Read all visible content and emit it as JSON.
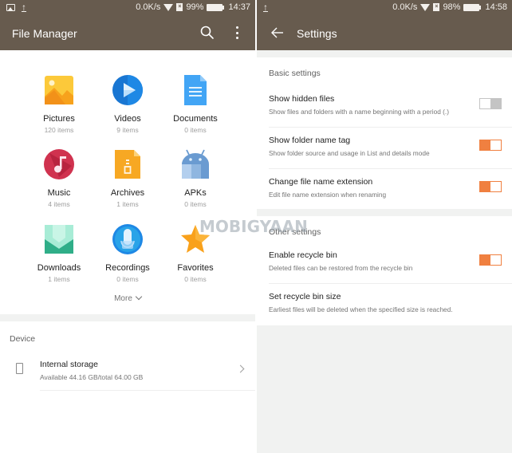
{
  "left_screen": {
    "status_bar": {
      "notification_icons": [
        "image-icon",
        "upload-icon"
      ],
      "network_speed": "0.0K/s",
      "battery": "99%",
      "time": "14:37"
    },
    "app_bar": {
      "title": "File Manager",
      "actions": [
        "search-icon",
        "more-vert-icon"
      ]
    },
    "categories": [
      {
        "name": "Pictures",
        "count": "120 items",
        "icon": "pictures-icon",
        "color": "#fbbf2a"
      },
      {
        "name": "Videos",
        "count": "9 items",
        "icon": "videos-icon",
        "color": "#1976d2"
      },
      {
        "name": "Documents",
        "count": "0 items",
        "icon": "documents-icon",
        "color": "#42a5f5"
      },
      {
        "name": "Music",
        "count": "4 items",
        "icon": "music-icon",
        "color": "#d0324f"
      },
      {
        "name": "Archives",
        "count": "1 items",
        "icon": "archives-icon",
        "color": "#f7a823"
      },
      {
        "name": "APKs",
        "count": "0 items",
        "icon": "apks-icon",
        "color": "#6a9bd1"
      },
      {
        "name": "Downloads",
        "count": "1 items",
        "icon": "downloads-icon",
        "color": "#3cbf9a"
      },
      {
        "name": "Recordings",
        "count": "0 items",
        "icon": "recordings-icon",
        "color": "#1e88e5"
      },
      {
        "name": "Favorites",
        "count": "0 items",
        "icon": "favorites-icon",
        "color": "#f9a11b"
      }
    ],
    "more_label": "More",
    "device": {
      "section_label": "Device",
      "storage": {
        "title": "Internal storage",
        "subtitle": "Available 44.16 GB/total 64.00 GB"
      }
    }
  },
  "right_screen": {
    "status_bar": {
      "notification_icons": [
        "upload-icon"
      ],
      "network_speed": "0.0K/s",
      "battery": "98%",
      "time": "14:58"
    },
    "app_bar": {
      "title": "Settings"
    },
    "basic_settings": {
      "header": "Basic settings",
      "items": [
        {
          "title": "Show hidden files",
          "subtitle": "Show files and folders with a name beginning with a period (.)",
          "enabled": false
        },
        {
          "title": "Show folder name tag",
          "subtitle": "Show folder source and usage in List and details mode",
          "enabled": true
        },
        {
          "title": "Change file name extension",
          "subtitle": "Edit file name extension when renaming",
          "enabled": true
        }
      ]
    },
    "other_settings": {
      "header": "Other settings",
      "items": [
        {
          "title": "Enable recycle bin",
          "subtitle": "Deleted files can be restored from the recycle bin",
          "enabled": true
        },
        {
          "title": "Set recycle bin size",
          "subtitle": "Earliest files will be deleted when the specified size is reached."
        }
      ]
    }
  },
  "watermark": "MOBIGYAAN",
  "colors": {
    "app_bar": "#675b4e",
    "accent_toggle": "#f08040",
    "background_gray": "#f1f2f1"
  }
}
